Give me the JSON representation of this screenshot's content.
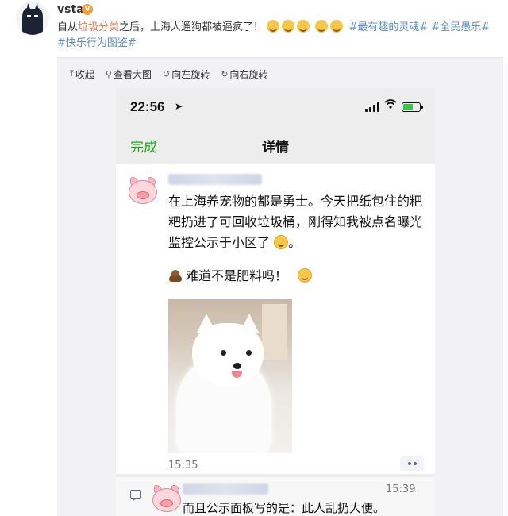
{
  "post": {
    "username": "vsta",
    "verified_badge": "V",
    "text_prefix": "自从",
    "text_highlight": "垃圾分类",
    "text_suffix": "之后，上海人遛狗都被逼疯了！",
    "tags": [
      "#最有趣的灵魂#",
      "#全民愚乐#",
      "#快乐行为图鉴#"
    ]
  },
  "toolbar": {
    "collapse": "收起",
    "view_large": "查看大图",
    "rotate_left": "向左旋转",
    "rotate_right": "向右旋转"
  },
  "phone": {
    "time": "22:56",
    "nav_done": "完成",
    "nav_title": "详情",
    "message_line1": "在上海养宠物的都是勇士。今天把纸包住的粑粑扔进了可回收垃圾桶，刚得知我被点名曝光监控公示于小区了",
    "message_line2": "难道不是肥料吗！",
    "timestamp1": "15:35",
    "timestamp2": "15:39",
    "reply_text": "而且公示面板写的是：此人乱扔大便。"
  },
  "colors": {
    "accent_link": "#eb7350",
    "wechat_green": "#1aad19",
    "tag_blue": "#5b8ac4"
  }
}
